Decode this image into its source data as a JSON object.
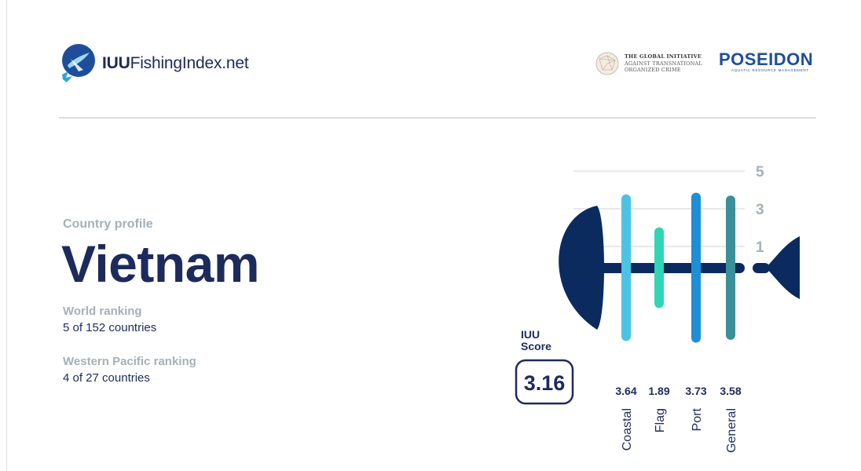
{
  "header": {
    "logo_bold": "IUU",
    "logo_rest": "FishingIndex.net",
    "partner1_lines": [
      "THE GLOBAL INITIATIVE",
      "AGAINST TRANSNATIONAL",
      "ORGANIZED CRIME"
    ],
    "partner2_name": "POSEIDON",
    "partner2_sub": "AQUATIC RESOURCE MANAGEMENT"
  },
  "profile": {
    "eyebrow": "Country profile",
    "country": "Vietnam",
    "world_ranking_label": "World ranking",
    "world_ranking_value": "5 of 152 countries",
    "region_ranking_label": "Western Pacific ranking",
    "region_ranking_value": "4 of 27 countries"
  },
  "chart_data": {
    "type": "bar",
    "score_label_lines": [
      "IUU",
      "Score"
    ],
    "overall_score": 3.16,
    "overall_score_text": "3.16",
    "categories": [
      "Coastal",
      "Flag",
      "Port",
      "General"
    ],
    "values": [
      3.64,
      1.89,
      3.73,
      3.58
    ],
    "value_labels": [
      "3.64",
      "1.89",
      "3.73",
      "3.58"
    ],
    "colors": [
      "#4cc3e3",
      "#2fd6b3",
      "#1e8fd6",
      "#3a8f99"
    ],
    "yticks": [
      "5",
      "3",
      "1"
    ],
    "ylim": [
      1,
      5
    ],
    "grid": true
  },
  "colors": {
    "navy": "#1d2a5c",
    "grey": "#a6b0b6",
    "fish": "#0b2a5e"
  }
}
